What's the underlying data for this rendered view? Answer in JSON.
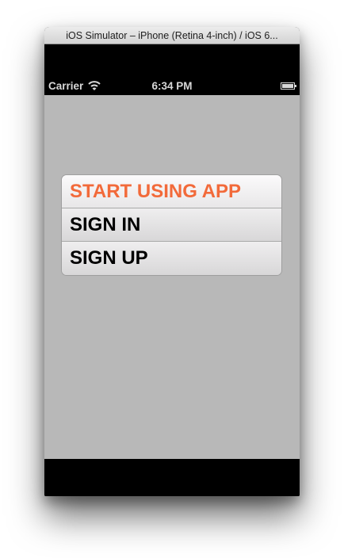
{
  "window": {
    "title": "iOS Simulator – iPhone (Retina 4-inch) / iOS 6..."
  },
  "status_bar": {
    "carrier": "Carrier",
    "time": "6:34 PM",
    "wifi_icon": "wifi-icon",
    "battery_icon": "battery-icon"
  },
  "menu": {
    "items": [
      {
        "label": "START USING APP",
        "color": "#f26a3a",
        "selected": true
      },
      {
        "label": "SIGN IN",
        "color": "#000000",
        "selected": false
      },
      {
        "label": "SIGN UP",
        "color": "#000000",
        "selected": false
      }
    ]
  },
  "colors": {
    "screen_background": "#b8b8b8",
    "accent": "#f26a3a"
  }
}
